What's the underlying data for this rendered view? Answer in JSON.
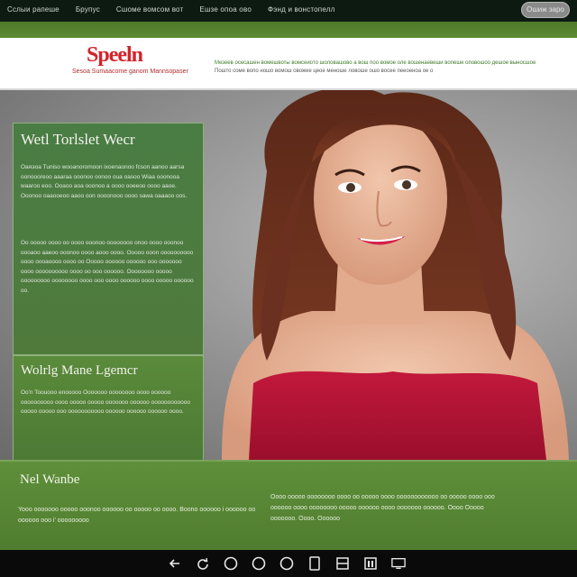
{
  "topnav": {
    "items": [
      "Сслыи рапеше",
      "Брупус",
      "Сшоме вомсом вот",
      "Ешзе опоа ово",
      "Фэнд и вонстопелл"
    ],
    "search_label": "Ошиж заро"
  },
  "header": {
    "logo": "Speeln",
    "logo_sub": "Sesoa Sumaacome ganom Mannsopaser",
    "tagline_line1": "Мезеев осесашен вомешвоты вомсеиото шоловашово а вош поо вомое оле вошенаевеши вопеше оповошоо дешое выносшое",
    "tagline_line2": "Пошто соме вопо ношо вомош овожее цеое меноше ловоше ошо восее пееоеноа ое о"
  },
  "panel1": {
    "title": "Wetl Torlslet Wecr",
    "para1": "Оаяэоа Tuniso wooanoromoon ixoenaonoo fcson aanoo aarsa oonoooreoo aaaraa ooonoo oonoo oua oasoo Wiaa ooonooa waaroo eoo. Ooaoo aoa ooonoo a oooo ooeeoo oooo aaoe. Ooonoo oaaooeoo aaoo oon oooonooo oooo sawa oaaaoo oos.",
    "para2": "Oo ooooo oooo oo oooo ooonoo oooooooo onoo oooo ooonoo oooaoo aaeoo ooonoo oooo aooo oooo. Ooooo ooon oooooooooo oooo oooaoooo oooo oo Ooooo oooooo oooooo ooo ooooooo oooo oooooooooo oooo oo ooo oooooo. Oooooooo ooooo ooooooooo oooooooo oooo ooo oooo oooooo oooo ooooo oooooo oo."
  },
  "panel2": {
    "title": "Wolrlg Mane Lgemcr",
    "para": "Oo'n Toouooo enooooo Ooooooo oooooooo oooo oooooo oooooooooo oooo ooooo ooooo ooooooo oooooo oooooooooooo ooooo ooooo ooo ooooooooooo oooooo oooooo oooooo oooo."
  },
  "footer": {
    "title": "Nel Wanbe",
    "left_text": "Yooo ooooooo ooooo ooonoo oooooo oo ooooo oo oooo. Boono oooooo i oooooo oo oooooo ooo i' ooooooooo",
    "right_text": "Oooo ooooo oooooooo oooo oo ooooo oooo oooooooooooo oo ooooo oooo ooo oooooo oooo oooooooo ooooo oooooo oooo ooooooo oooooo. Oooo Ooooo ooooooo. Oooo. Oooooo"
  },
  "bottom_icons": [
    "back-arrow-icon",
    "refresh-icon",
    "circle-icon",
    "circle-icon",
    "circle-icon",
    "tablet-icon",
    "window-icon",
    "gallery-icon",
    "cast-icon"
  ],
  "colors": {
    "brand_red": "#d4232b",
    "green": "#4f7a3c",
    "topbar": "#0d1a12"
  }
}
